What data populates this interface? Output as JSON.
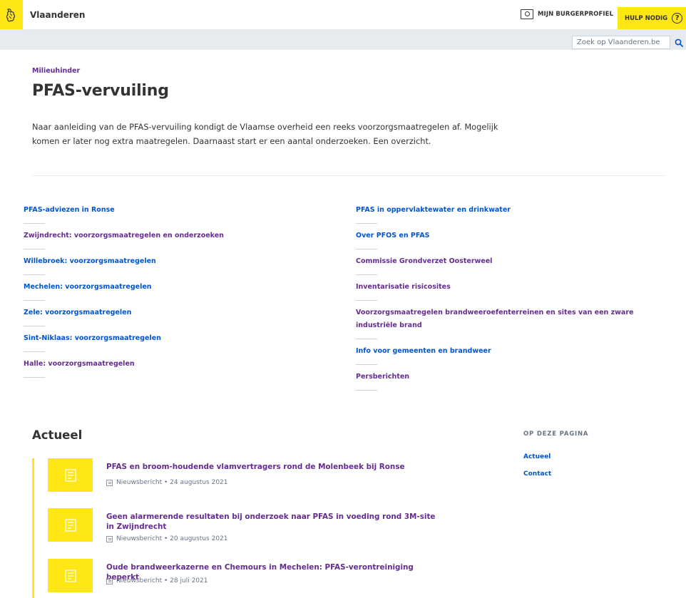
{
  "header": {
    "brand": "Vlaanderen",
    "profile_label": "MIJN BURGERPROFIEL",
    "help_label": "HULP NODIG",
    "brand_color": "#ffe615"
  },
  "search": {
    "placeholder": "Zoek op Vlaanderen.be"
  },
  "breadcrumb": "Milieuhinder",
  "title": "PFAS-vervuiling",
  "intro": "Naar aanleiding van de PFAS-vervuiling kondigt de Vlaamse overheid een reeks voorzorgsmaatregelen af. Mogelijk komen er later nog extra maatregelen. Daarnaast start er een aantal onderzoeken. Een overzicht.",
  "links_left": [
    {
      "label": "PFAS-adviezen in Ronse"
    },
    {
      "label": "Zwijndrecht: voorzorgsmaatregelen en onderzoeken"
    },
    {
      "label": "Willebroek: voorzorgsmaatregelen"
    },
    {
      "label": "Mechelen: voorzorgsmaatregelen"
    },
    {
      "label": "Zele: voorzorgsmaatregelen"
    },
    {
      "label": "Sint-Niklaas: voorzorgsmaatregelen"
    },
    {
      "label": "Halle: voorzorgsmaatregelen"
    }
  ],
  "links_right": [
    {
      "label": "PFAS in oppervlaktewater en drinkwater"
    },
    {
      "label": "Over PFOS en PFAS"
    },
    {
      "label": "Commissie Grondverzet Oosterweel"
    },
    {
      "label": "Inventarisatie risicosites"
    },
    {
      "label": "Voorzorgsmaatregelen brandweeroefenterreinen en sites van een zware industriële brand"
    },
    {
      "label": "Info voor gemeenten en brandweer"
    },
    {
      "label": "Persberichten"
    }
  ],
  "news": {
    "title": "Actueel",
    "items": [
      {
        "title": "PFAS en broom-houdende vlamvertragers rond de Molenbeek bij Ronse",
        "meta": "Nieuwsbericht • 24 augustus 2021"
      },
      {
        "title": "Geen alarmerende resultaten bij onderzoek naar PFAS in voeding rond 3M-site in Zwijndrecht",
        "meta": "Nieuwsbericht • 20 augustus 2021"
      },
      {
        "title": "Oude brandweerkazerne en Chemours in Mechelen: PFAS-verontreiniging beperkt",
        "meta": "Nieuwsbericht • 28 juli 2021"
      }
    ]
  },
  "side_nav": {
    "title": "OP DEZE PAGINA",
    "items": [
      {
        "label": "Actueel"
      },
      {
        "label": "Contact"
      }
    ]
  }
}
